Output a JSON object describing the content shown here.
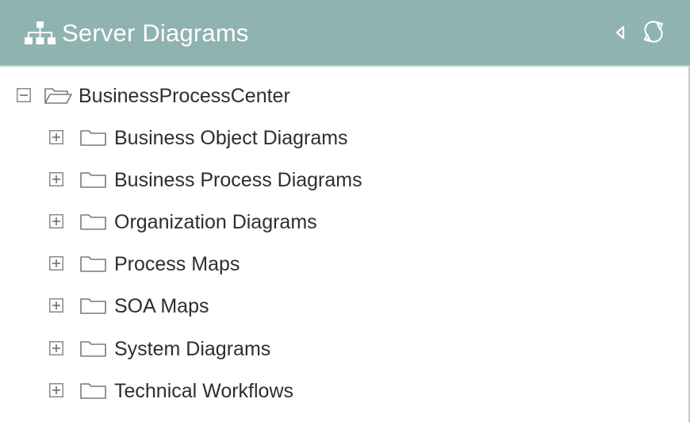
{
  "header": {
    "title": "Server Diagrams",
    "icon": "org-chart-icon",
    "collapse_icon": "caret-left-icon",
    "refresh_icon": "refresh-icon",
    "background": "#8fb3b0"
  },
  "tree": {
    "root": {
      "label": "BusinessProcessCenter",
      "state": "expanded"
    },
    "children": [
      {
        "label": "Business Object Diagrams",
        "state": "collapsed"
      },
      {
        "label": "Business Process Diagrams",
        "state": "collapsed"
      },
      {
        "label": "Organization Diagrams",
        "state": "collapsed"
      },
      {
        "label": "Process Maps",
        "state": "collapsed"
      },
      {
        "label": "SOA Maps",
        "state": "collapsed"
      },
      {
        "label": "System Diagrams",
        "state": "collapsed"
      },
      {
        "label": "Technical Workflows",
        "state": "collapsed"
      }
    ]
  }
}
